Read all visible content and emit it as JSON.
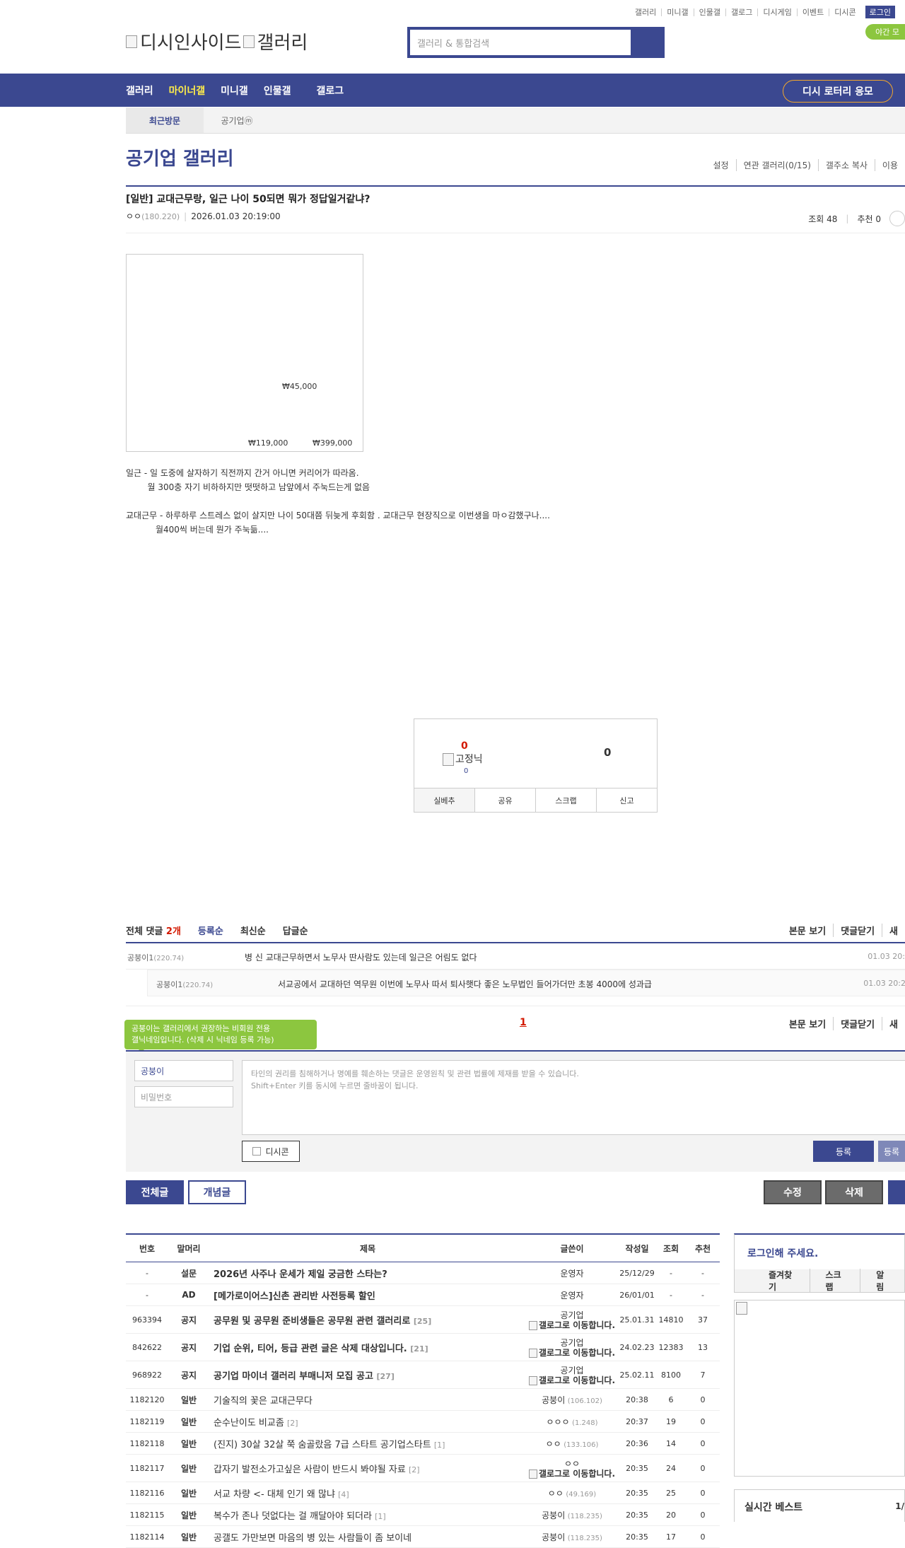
{
  "util": {
    "links": [
      "갤러리",
      "미니갤",
      "인물갤",
      "갤로그",
      "디시게임",
      "이벤트",
      "디시콘"
    ],
    "login": "로그인",
    "night": "야간 모"
  },
  "logo": {
    "text1": "디시인사이드",
    "text2": "갤러리"
  },
  "search": {
    "placeholder": "갤러리 & 통합검색"
  },
  "nav": {
    "items": [
      "갤러리",
      "마이너갤",
      "미니갤",
      "인물갤",
      "갤로그"
    ],
    "lotto": "디시 로터리 응모"
  },
  "recent": {
    "current": "최근방문",
    "other": "공기업ⓜ"
  },
  "gallery": {
    "title": "공기업 갤러리",
    "menu": [
      "설정",
      "연관 갤러리(0/15)",
      "갤주소 복사",
      "이용"
    ]
  },
  "post": {
    "title": "[일반] 교대근무랑, 일근 나이 50되면 뭐가 정답일거같냐?",
    "nick": "ㅇㅇ",
    "ip": "(180.220)",
    "date": "2026.01.03 20:19:00",
    "views": "조회 48",
    "recommend": "추천 0",
    "image_prices": [
      "₩45,000",
      "₩119,000",
      "₩399,000"
    ],
    "body": "일근 - 일 도중에 살자하기 직전까지 간거 아니면 커리어가 따라옴.\n        월 300충 자기 비하하지만 떳떳하고 남앞에서 주눅드는게 없음\n\n교대근무 - 하루하루 스트레스 없이 살지만 나이 50대쯤 뒤늦게 후회함 . 교대근무 현장직으로 이번생을 마ㅇ감했구나....\n           월400씩 버는데 뭔가 주눅듦...."
  },
  "recom": {
    "up": "0",
    "fixed": "고정닉",
    "fixed_count": "0",
    "down": "0",
    "buttons": [
      "실베추",
      "공유",
      "스크랩",
      "신고"
    ]
  },
  "comments": {
    "label": "전체 댓글",
    "count": "2개",
    "sorts": [
      "등록순",
      "최신순",
      "답글순"
    ],
    "right": [
      "본문 보기",
      "댓글닫기",
      "새"
    ],
    "items": [
      {
        "nick": "공붕이1",
        "ip": "(220.74)",
        "text": "병 신 교대근무하면서 노무사 딴사람도 있는데 일근은 어림도 없다",
        "date": "01.03 20:"
      },
      {
        "nick": "공붕이1",
        "ip": "(220.74)",
        "text": "서교공에서 교대하던 역무원 이번에 노무사 따서 퇴사햇다 좋은 노무법인 들어가더만 초봉 4000에 성과급",
        "date": "01.03 20:2"
      }
    ],
    "page": "1"
  },
  "write": {
    "tooltip": "공붕이는 갤러리에서 권장하는 비회원 전용\n갤닉네임입니다. (삭제 시 닉네임 등록 가능)",
    "nick_value": "공붕이",
    "pw_placeholder": "비밀번호",
    "textarea": "타인의 권리를 침해하거나 명예를 훼손하는 댓글은 운영원칙 및 관련 법률에 제재를 받을 수 있습니다.\nShift+Enter 키를 동시에 누르면 줄바꿈이 됩니다.",
    "dccon": "디시콘",
    "submit": "등록",
    "submit2": "등록"
  },
  "buttons": {
    "all": "전체글",
    "concept": "개념글",
    "edit": "수정",
    "delete": "삭제"
  },
  "board": {
    "headers": [
      "번호",
      "말머리",
      "제목",
      "글쓴이",
      "작성일",
      "조회",
      "추천"
    ],
    "rows": [
      {
        "no": "-",
        "head": "설문",
        "title": "2026년 사주나 운세가 제일 궁금한 스타는?",
        "rc": "",
        "writer": "운영자",
        "ip": "",
        "date": "25/12/29",
        "views": "-",
        "rec": "-",
        "bold": true
      },
      {
        "no": "-",
        "head": "AD",
        "title": "[메가로이어스]신촌 관리반 사전등록 할인",
        "rc": "",
        "writer": "운영자",
        "ip": "",
        "date": "26/01/01",
        "views": "-",
        "rec": "-",
        "bold": true
      },
      {
        "no": "963394",
        "head": "공지",
        "title": "공무원 및 공무원 준비생들은 공무원 관련 갤러리로",
        "rc": "[25]",
        "writer": "공기업",
        "ip": "갤로그로 이동합니다.",
        "date": "25.01.31",
        "views": "14810",
        "rec": "37",
        "bold": true,
        "gallog": true
      },
      {
        "no": "842622",
        "head": "공지",
        "title": "기업 순위, 티어, 등급 관련 글은 삭제 대상입니다.",
        "rc": "[21]",
        "writer": "공기업",
        "ip": "갤로그로 이동합니다.",
        "date": "24.02.23",
        "views": "12383",
        "rec": "13",
        "bold": true,
        "gallog": true
      },
      {
        "no": "968922",
        "head": "공지",
        "title": "공기업 마이너 갤러리 부매니저 모집 공고",
        "rc": "[27]",
        "writer": "공기업",
        "ip": "갤로그로 이동합니다.",
        "date": "25.02.11",
        "views": "8100",
        "rec": "7",
        "bold": true,
        "gallog": true
      },
      {
        "no": "1182120",
        "head": "일반",
        "title": "기술직의 꽃은 교대근무다",
        "rc": "",
        "writer": "공붕이",
        "ip": "(106.102)",
        "date": "20:38",
        "views": "6",
        "rec": "0"
      },
      {
        "no": "1182119",
        "head": "일반",
        "title": "순수난이도 비교좀",
        "rc": "[2]",
        "writer": "ㅇㅇㅇ",
        "ip": "(1.248)",
        "date": "20:37",
        "views": "19",
        "rec": "0"
      },
      {
        "no": "1182118",
        "head": "일반",
        "title": "(진지) 30살 32살 쭉 숨골랐음 7급 스타트 공기업스타트",
        "rc": "[1]",
        "writer": "ㅇㅇ",
        "ip": "(133.106)",
        "date": "20:36",
        "views": "14",
        "rec": "0"
      },
      {
        "no": "1182117",
        "head": "일반",
        "title": "갑자기 발전소가고싶은 사람이 반드시 봐야될 자료",
        "rc": "[2]",
        "writer": "ㅇㅇ",
        "ip": "갤로그로 이동합니다.",
        "date": "20:35",
        "views": "24",
        "rec": "0",
        "gallog": true
      },
      {
        "no": "1182116",
        "head": "일반",
        "title": "서교 차량 <- 대체 인기 왜 많냐",
        "rc": "[4]",
        "writer": "ㅇㅇ",
        "ip": "(49.169)",
        "date": "20:35",
        "views": "25",
        "rec": "0"
      },
      {
        "no": "1182115",
        "head": "일반",
        "title": "복수가 존나 덧없다는 걸 깨달아야 되더라",
        "rc": "[1]",
        "writer": "공붕이",
        "ip": "(118.235)",
        "date": "20:35",
        "views": "20",
        "rec": "0"
      },
      {
        "no": "1182114",
        "head": "일반",
        "title": "공갤도 가만보면 마음의 병 있는 사람들이 좀 보이네",
        "rc": "",
        "writer": "공붕이",
        "ip": "(118.235)",
        "date": "20:35",
        "views": "17",
        "rec": "0"
      }
    ]
  },
  "side": {
    "login_prompt": "로그인해 주세요.",
    "links": [
      "즐겨찾기",
      "스크랩",
      "알림"
    ],
    "best": "실시간 베스트",
    "best_page": "1/"
  }
}
